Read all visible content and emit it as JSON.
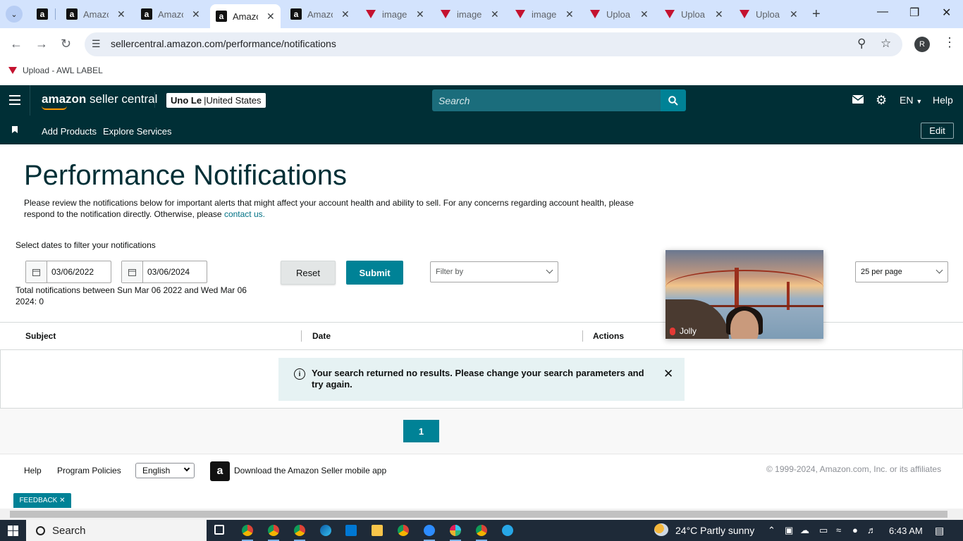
{
  "browser": {
    "tabs": [
      {
        "title": "",
        "icon": "amazon-icon",
        "active": false
      },
      {
        "title": "Amazo",
        "icon": "amazon-icon",
        "active": false
      },
      {
        "title": "Amazo",
        "icon": "amazon-icon",
        "active": false
      },
      {
        "title": "Amazo",
        "icon": "amazon-icon",
        "active": true
      },
      {
        "title": "Amazo",
        "icon": "amazon-icon",
        "active": false
      },
      {
        "title": "image",
        "icon": "awl-icon",
        "active": false
      },
      {
        "title": "image",
        "icon": "awl-icon",
        "active": false
      },
      {
        "title": "image",
        "icon": "awl-icon",
        "active": false
      },
      {
        "title": "Uploa",
        "icon": "awl-icon",
        "active": false
      },
      {
        "title": "Uploa",
        "icon": "awl-icon",
        "active": false
      },
      {
        "title": "Uploa",
        "icon": "awl-icon",
        "active": false
      }
    ],
    "url": "sellercentral.amazon.com/performance/notifications",
    "profile_initial": "R",
    "bookmark": "Upload - AWL LABEL"
  },
  "header": {
    "logo_bold": "amazon",
    "logo_rest": " seller central",
    "account_name": "Uno Le",
    "account_sep": " | ",
    "account_region": "United States",
    "search_placeholder": "Search",
    "language": "EN",
    "help": "Help"
  },
  "nav": {
    "add_products": "Add Products",
    "explore_services": "Explore Services",
    "edit": "Edit"
  },
  "main": {
    "title": "Performance Notifications",
    "intro": "Please review the notifications below for important alerts that might affect your account health and ability to sell. For any concerns regarding account health, please respond to the notification directly. Otherwise, please ",
    "contact_link": "contact us.",
    "filter_label": "Select dates to filter your notifications",
    "date_from": "03/06/2022",
    "date_to": "03/06/2024",
    "reset": "Reset",
    "submit": "Submit",
    "filter_by": "Filter by",
    "per_page": "25 per page",
    "totals": "Total notifications between Sun Mar 06 2022 and Wed Mar 06 2024: 0",
    "columns": [
      "Subject",
      "Date",
      "Actions"
    ],
    "no_results": "Your search returned no results. Please change your search parameters and try again.",
    "page": "1"
  },
  "video": {
    "participant": "Jolly"
  },
  "footer": {
    "help": "Help",
    "program_policies": "Program Policies",
    "language": "English",
    "download_app": "Download the Amazon Seller mobile app",
    "copyright": "© 1999-2024, Amazon.com, Inc. or its affiliates",
    "feedback": "FEEDBACK"
  },
  "taskbar": {
    "search": "Search",
    "weather": "24°C  Partly sunny",
    "time": "6:43 AM"
  },
  "colors": {
    "header_bg": "#002f36",
    "accent": "#008296",
    "link": "#007185"
  }
}
